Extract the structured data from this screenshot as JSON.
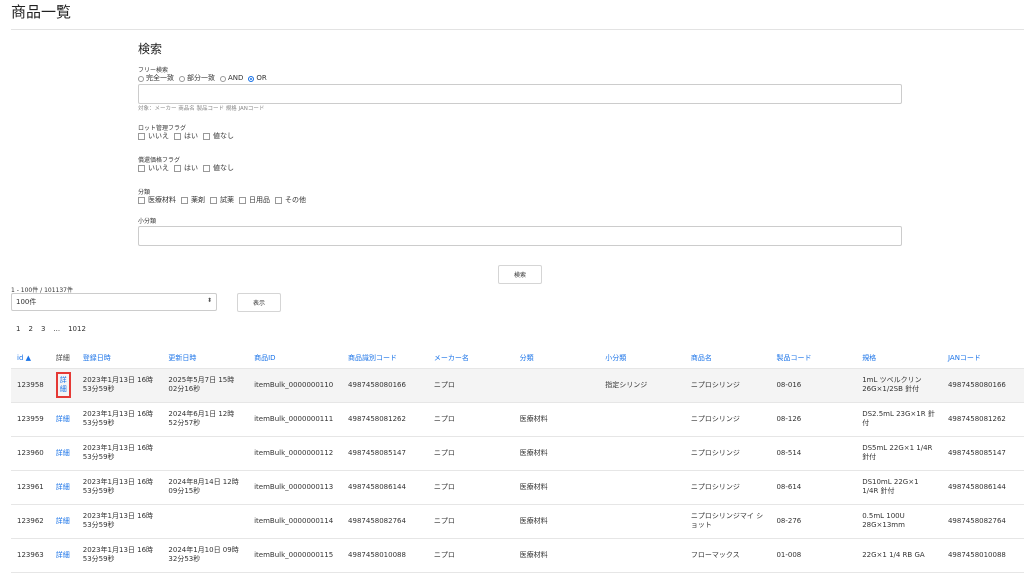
{
  "page_title": "商品一覧",
  "search": {
    "heading": "検索",
    "free_label": "フリー検索",
    "free_modes": [
      {
        "label": "完全一致",
        "checked": false
      },
      {
        "label": "部分一致",
        "checked": false
      },
      {
        "label": "AND",
        "checked": false
      },
      {
        "label": "OR",
        "checked": true
      }
    ],
    "free_hint": "対象：メーカー 商品名 製品コード 規格 JANコード",
    "lot_label": "ロット管理フラグ",
    "lot_opts": [
      "いいえ",
      "はい",
      "値なし"
    ],
    "price_label": "償還価格フラグ",
    "price_opts": [
      "いいえ",
      "はい",
      "値なし"
    ],
    "cat_label": "分類",
    "cat_opts": [
      "医療材料",
      "薬剤",
      "試薬",
      "日用品",
      "その他"
    ],
    "subcat_label": "小分類",
    "submit": "検索"
  },
  "count_text": "1 - 100件 / 101137件",
  "per_page": "100件",
  "show_button": "表示",
  "pages": [
    "1",
    "2",
    "3",
    "...",
    "1012"
  ],
  "headers": [
    "id ▲",
    "詳細",
    "登録日時",
    "更新日時",
    "商品ID",
    "商品識別コード",
    "メーカー名",
    "分類",
    "小分類",
    "商品名",
    "製品コード",
    "規格",
    "JANコード"
  ],
  "rows": [
    [
      "123958",
      "詳細",
      "2023年1月13日 16時 53分59秒",
      "2025年5月7日 15時 02分16秒",
      "itemBulk_0000000110",
      "4987458080166",
      "ニプロ",
      "",
      "指定シリンジ",
      "ニプロシリンジ",
      "08-016",
      "1mL ツベルクリン 26G×1/2SB 針付",
      "4987458080166"
    ],
    [
      "123959",
      "詳細",
      "2023年1月13日 16時 53分59秒",
      "2024年6月1日 12時 52分57秒",
      "itemBulk_0000000111",
      "4987458081262",
      "ニプロ",
      "医療材料",
      "",
      "ニプロシリンジ",
      "08-126",
      "DS2.5mL 23G×1R 針付",
      "4987458081262"
    ],
    [
      "123960",
      "詳細",
      "2023年1月13日 16時 53分59秒",
      "",
      "itemBulk_0000000112",
      "4987458085147",
      "ニプロ",
      "医療材料",
      "",
      "ニプロシリンジ",
      "08-514",
      "DS5mL 22G×1 1/4R 針付",
      "4987458085147"
    ],
    [
      "123961",
      "詳細",
      "2023年1月13日 16時 53分59秒",
      "2024年8月14日 12時 09分15秒",
      "itemBulk_0000000113",
      "4987458086144",
      "ニプロ",
      "医療材料",
      "",
      "ニプロシリンジ",
      "08-614",
      "DS10mL 22G×1 1/4R 針付",
      "4987458086144"
    ],
    [
      "123962",
      "詳細",
      "2023年1月13日 16時 53分59秒",
      "",
      "itemBulk_0000000114",
      "4987458082764",
      "ニプロ",
      "医療材料",
      "",
      "ニプロシリンジマイ ショット",
      "08-276",
      "0.5mL 100U 28G×13mm",
      "4987458082764"
    ],
    [
      "123963",
      "詳細",
      "2023年1月13日 16時 53分59秒",
      "2024年1月10日 09時 32分53秒",
      "itemBulk_0000000115",
      "4987458010088",
      "ニプロ",
      "医療材料",
      "",
      "フローマックス",
      "01-008",
      "22G×1 1/4 RB GA",
      "4987458010088"
    ]
  ]
}
